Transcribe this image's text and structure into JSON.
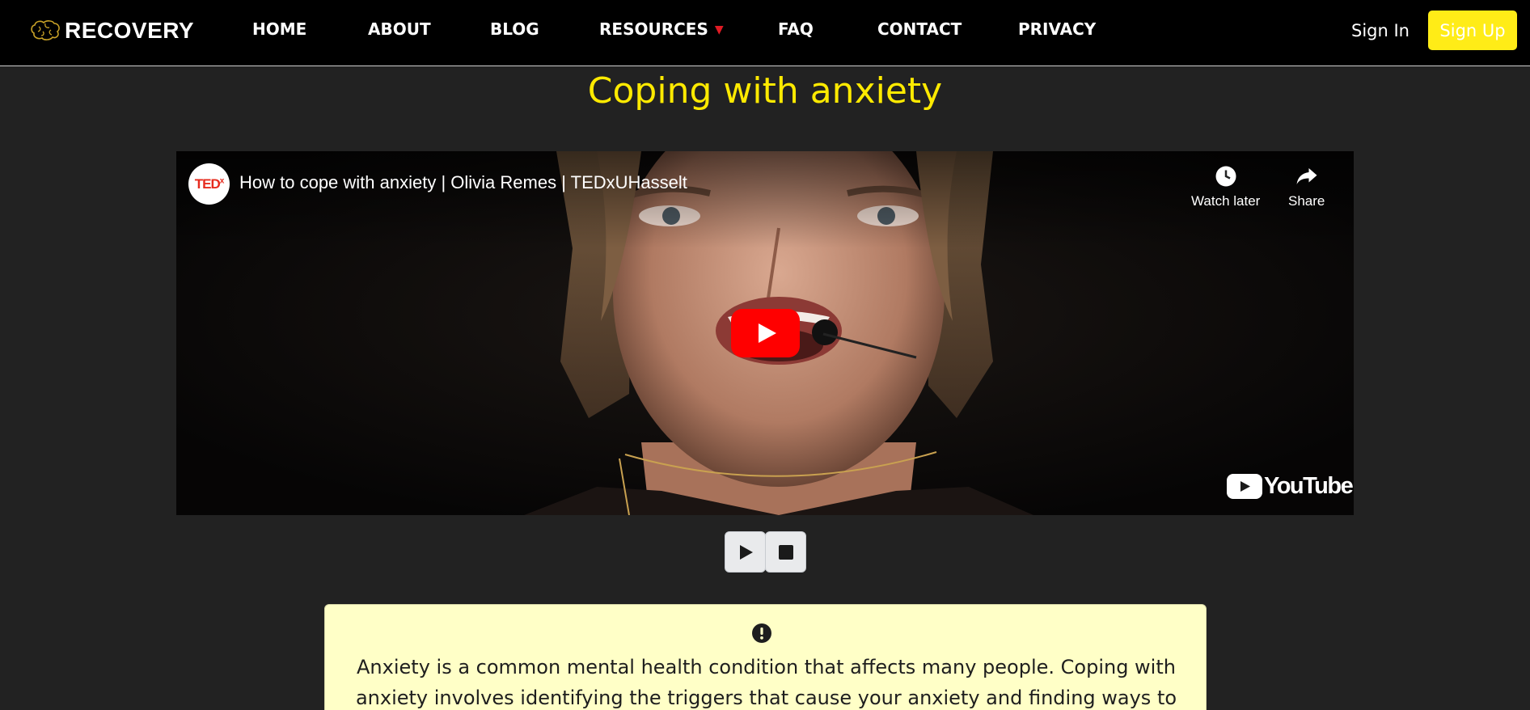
{
  "brand": {
    "name": "RECOVERY",
    "logo_icon": "brain-icon"
  },
  "nav": {
    "items": [
      {
        "label": "HOME"
      },
      {
        "label": "ABOUT"
      },
      {
        "label": "BLOG"
      },
      {
        "label": "RESOURCES",
        "has_dropdown": true
      },
      {
        "label": "FAQ"
      },
      {
        "label": "CONTACT"
      },
      {
        "label": "PRIVACY"
      }
    ],
    "dropdown_caret": "▼",
    "sign_in": "Sign In",
    "sign_up": "Sign Up"
  },
  "page": {
    "title": "Coping with anxiety"
  },
  "video": {
    "channel_badge": "TED",
    "channel_badge_sup": "x",
    "title": "How to cope with anxiety | Olivia Remes | TEDxUHasselt",
    "watch_later": "Watch later",
    "share": "Share",
    "platform_logo": "YouTube"
  },
  "audio_controls": {
    "play_icon": "play-icon",
    "stop_icon": "stop-icon"
  },
  "info_card": {
    "icon": "exclamation-circle-icon",
    "text": "Anxiety is a common mental health condition that affects many people. Coping with anxiety involves identifying the triggers that cause your anxiety and finding ways to manage your"
  },
  "colors": {
    "background": "#222222",
    "navbar": "#000000",
    "accent_yellow": "#ffea00",
    "signup_button": "#ffec17",
    "caret_red": "#e01b24",
    "info_card_bg": "#ffffc7",
    "youtube_red": "#ff0000"
  }
}
